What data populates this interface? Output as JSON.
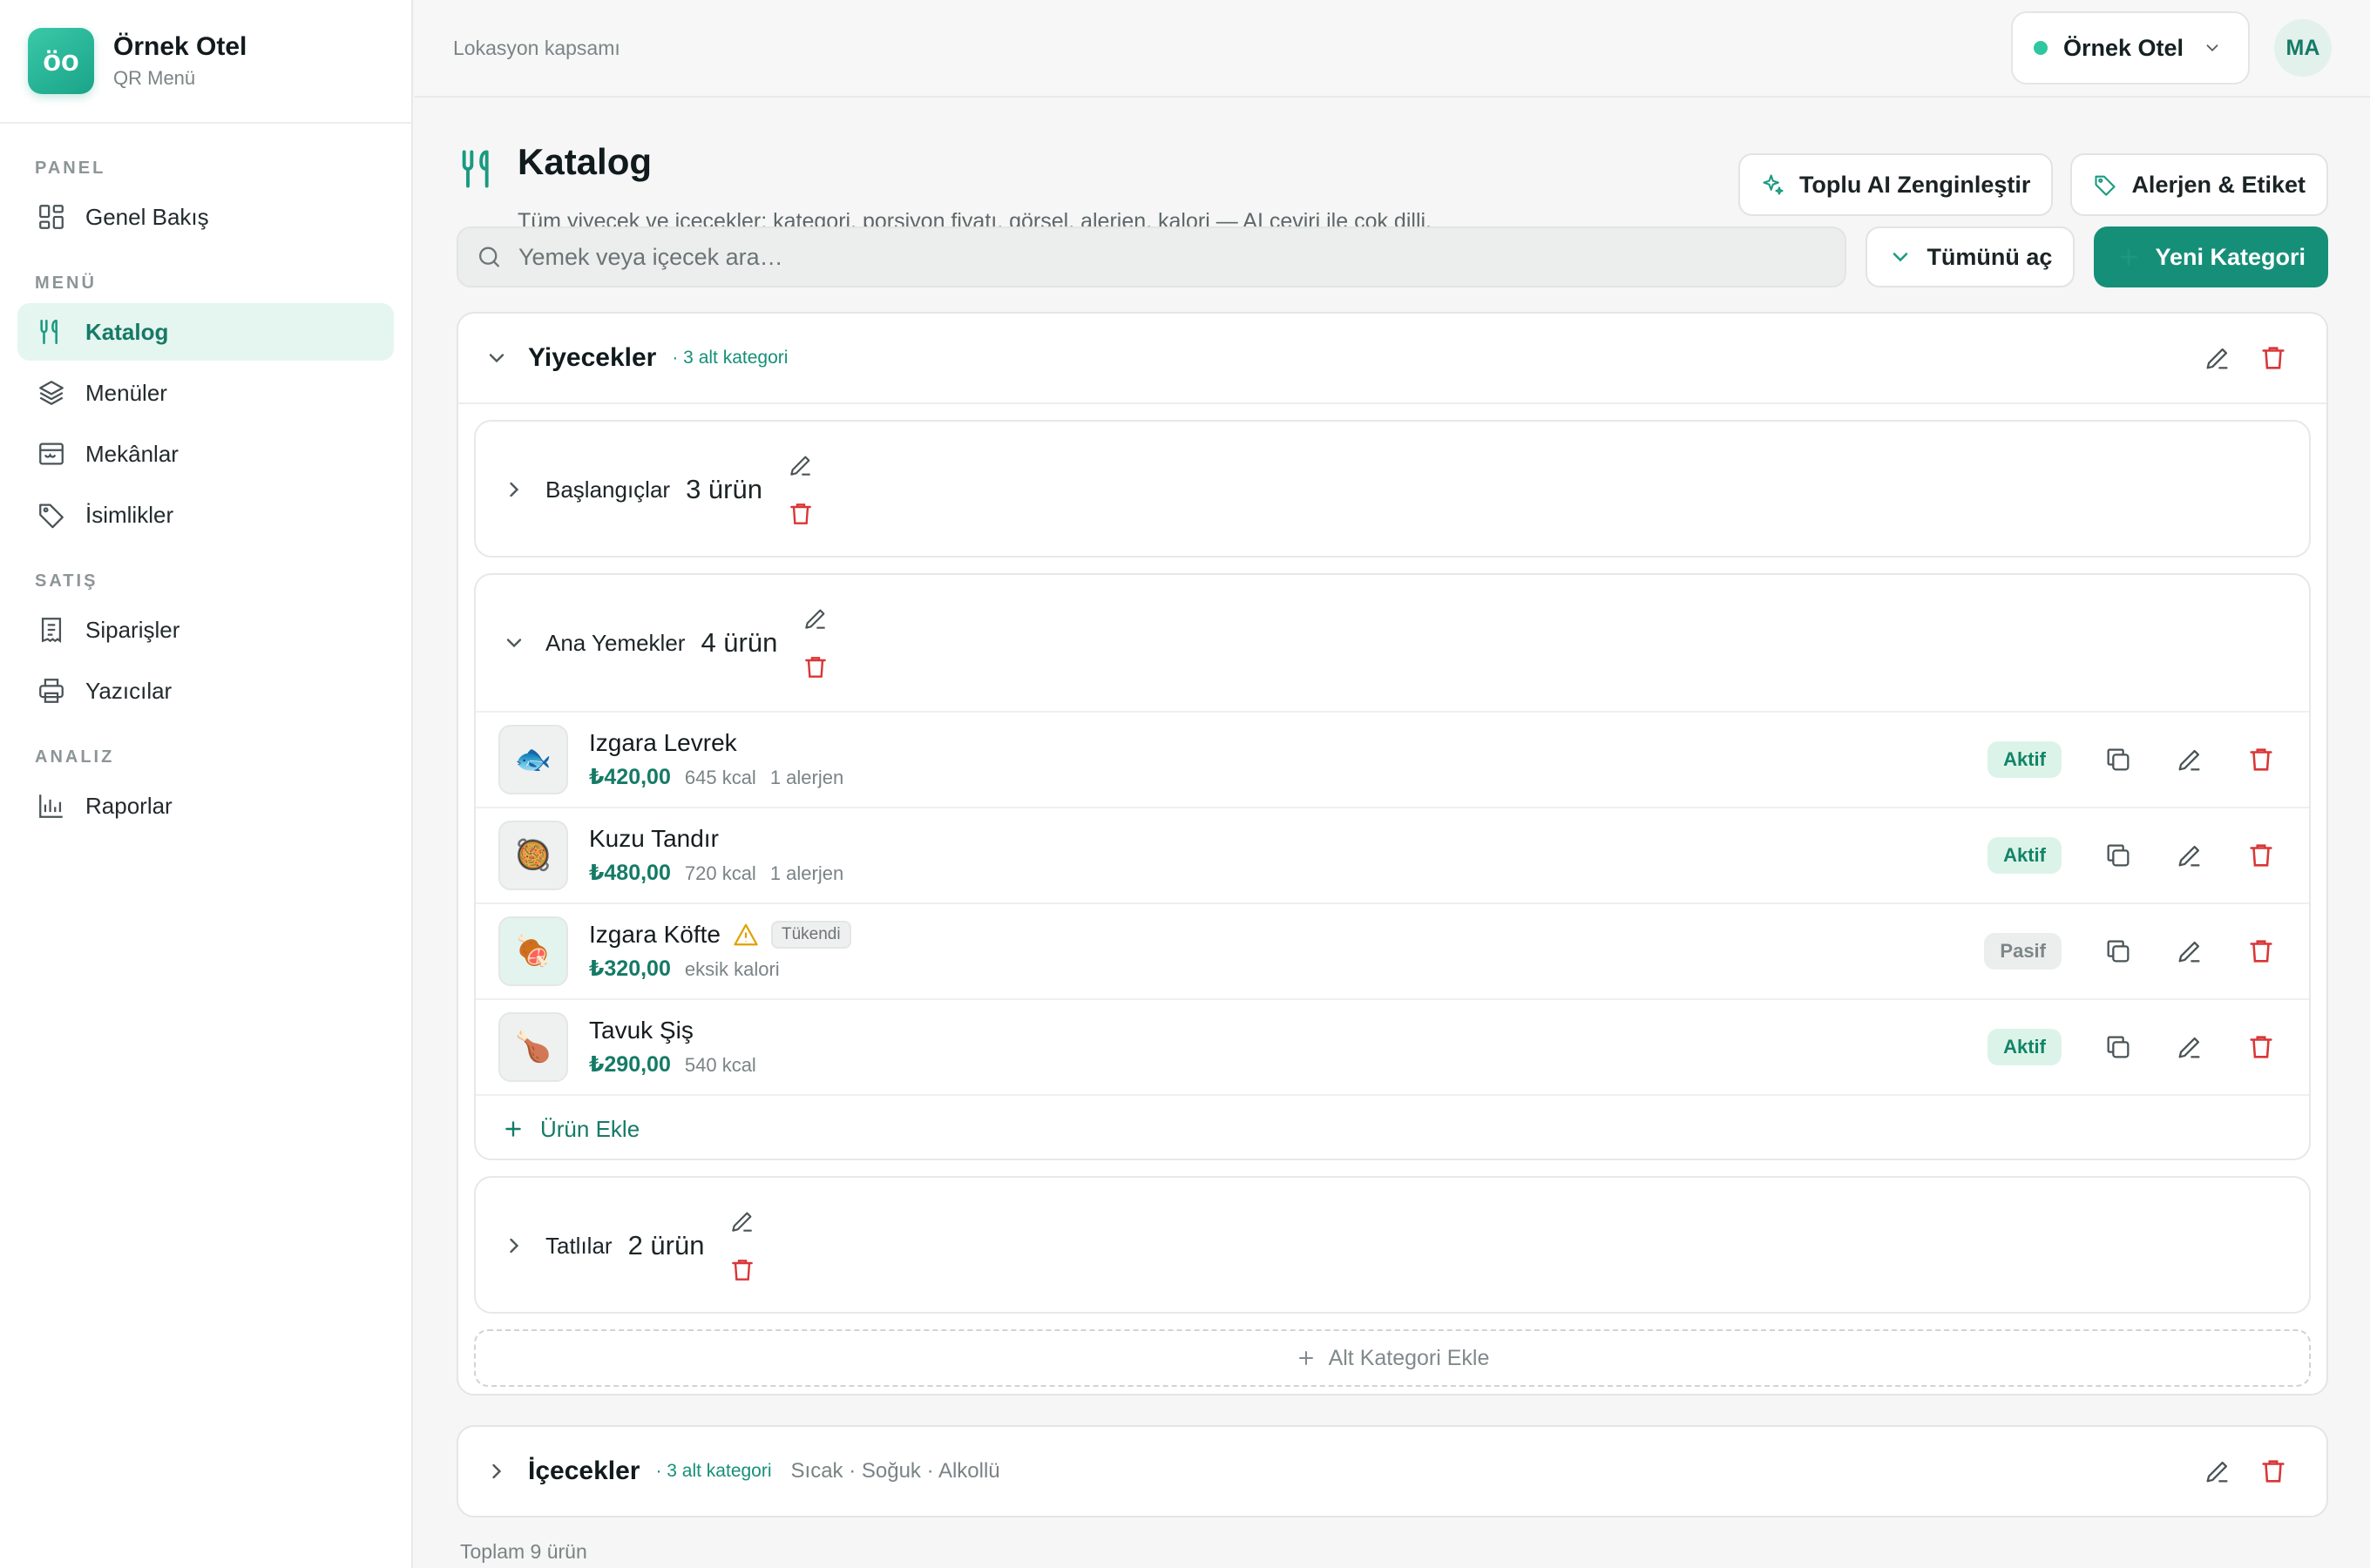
{
  "brand": {
    "logo": "öo",
    "name": "Örnek Otel",
    "sub": "QR Menü"
  },
  "nav": {
    "sections": [
      "PANEL",
      "MENÜ",
      "SATIŞ",
      "ANALIZ"
    ],
    "items": [
      {
        "label": "Genel Bakış",
        "icon": "dashboard-icon"
      },
      {
        "label": "Katalog",
        "icon": "utensils-icon",
        "active": true
      },
      {
        "label": "Menüler",
        "icon": "layers-icon"
      },
      {
        "label": "Mekânlar",
        "icon": "store-icon"
      },
      {
        "label": "İsimlikler",
        "icon": "tag-icon"
      },
      {
        "label": "Siparişler",
        "icon": "receipt-icon"
      },
      {
        "label": "Yazıcılar",
        "icon": "printer-icon"
      },
      {
        "label": "Raporlar",
        "icon": "chart-icon"
      }
    ]
  },
  "topbar": {
    "scope": "Lokasyon kapsamı",
    "location": "Örnek Otel",
    "avatar": "MA"
  },
  "page": {
    "title": "Katalog",
    "subtitle": "Tüm yiyecek ve içecekler; kategori, porsiyon fiyatı, görsel, alerjen, kalori — AI çeviri ile çok dilli.",
    "btn_ai": "Toplu AI Zenginleştir",
    "btn_allergen": "Alerjen & Etiket",
    "search_placeholder": "Yemek veya içecek ara…",
    "btn_expand": "Tümünü aç",
    "btn_new_category": "Yeni Kategori"
  },
  "categories": [
    {
      "name": "Yiyecekler",
      "count": "· 3 alt kategori",
      "subcategories": [
        {
          "name": "Başlangıçlar",
          "count": "3 ürün"
        },
        {
          "name": "Ana Yemekler",
          "count": "4 ürün",
          "items": [
            {
              "name": "Izgara Levrek",
              "price": "₺420,00",
              "kcal": "645 kcal",
              "allergen": "1 alerjen",
              "status": "Aktif",
              "thumb": "🐟"
            },
            {
              "name": "Kuzu Tandır",
              "price": "₺480,00",
              "kcal": "720 kcal",
              "allergen": "1 alerjen",
              "status": "Aktif",
              "thumb": "🥘"
            },
            {
              "name": "Izgara Köfte",
              "price": "₺320,00",
              "kcal": "eksik kalori",
              "badge": "Tükendi",
              "status": "Pasif",
              "thumb": "🍖"
            },
            {
              "name": "Tavuk Şiş",
              "price": "₺290,00",
              "kcal": "540 kcal",
              "status": "Aktif",
              "thumb": "🍗"
            }
          ],
          "add_item": "Ürün Ekle"
        },
        {
          "name": "Tatlılar",
          "count": "2 ürün"
        }
      ],
      "add_sub": "Alt Kategori Ekle"
    },
    {
      "name": "İçecekler",
      "count": "· 3 alt kategori",
      "tags": "Sıcak · Soğuk · Alkollü"
    }
  ],
  "footer": {
    "total": "Toplam 9 ürün"
  },
  "colors": {
    "accent": "#168f78",
    "danger": "#d93636",
    "warning": "#e0a100"
  }
}
